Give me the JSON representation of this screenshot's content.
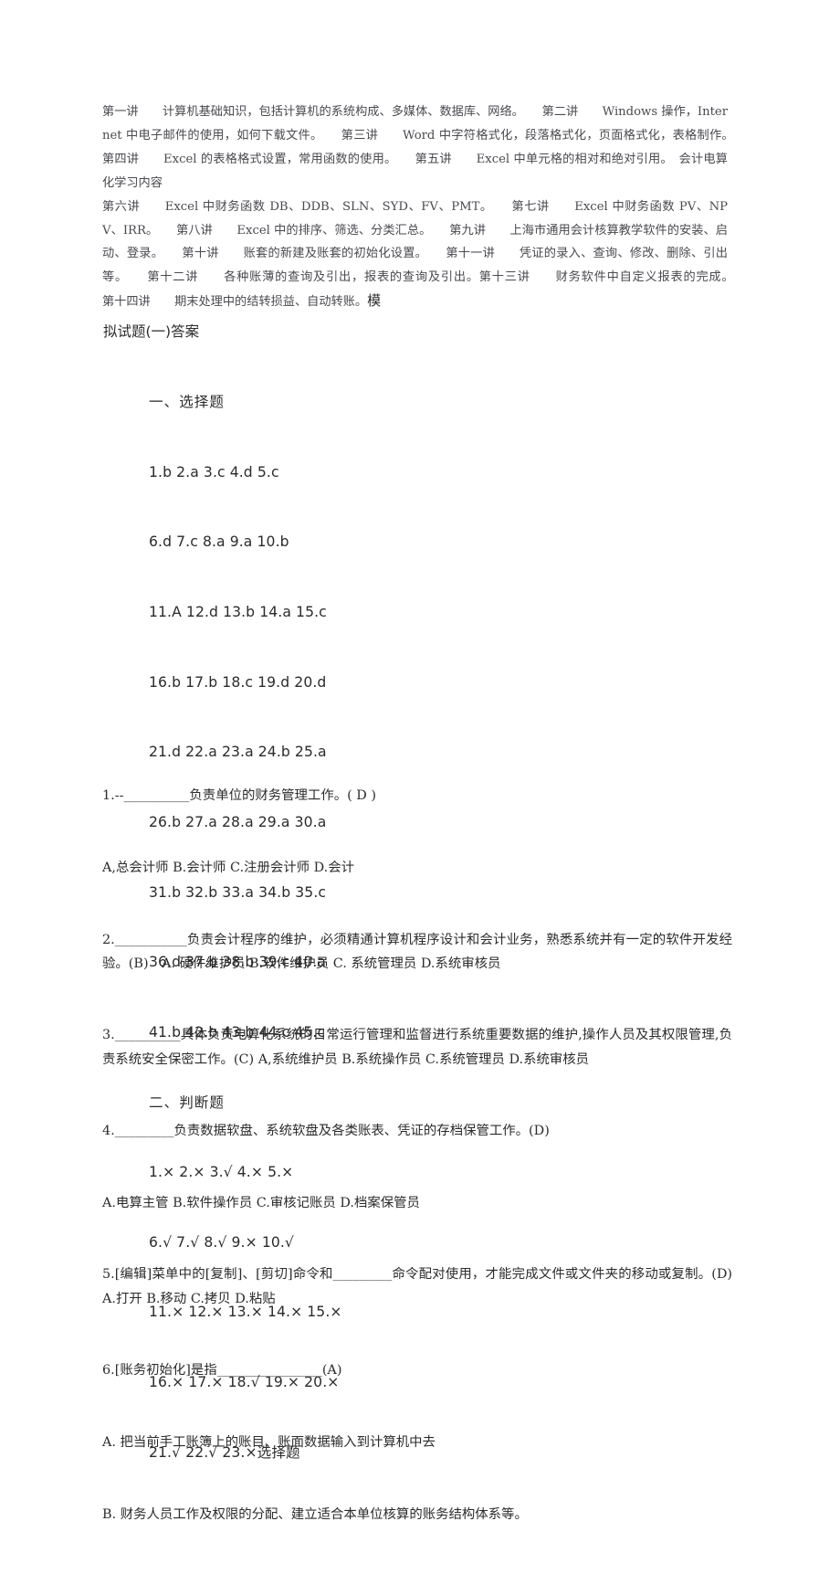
{
  "document": {
    "background_color": "#ffffff",
    "text_color": "#2b2b2b"
  },
  "outline": {
    "body": "第一讲　　计算机基础知识，包括计算机的系统构成、多媒体、数据库、网络。　　第二讲　　Windows 操作，Internet 中电子邮件的使用，如何下载文件。　　第三讲　　Word 中字符格式化，段落格式化，页面格式化，表格制作。　　第四讲　　Excel 的表格格式设置，常用函数的使用。　　第五讲　　Excel 中单元格的相对和绝对引用。　会计电算化学习内容\n第六讲　　Excel 中财务函数 DB、DDB、SLN、SYD、FV、PMT。　　第七讲　　Excel 中财务函数 PV、NPV、IRR。　　第八讲　　Excel 中的排序、筛选、分类汇总。　　第九讲　　上海市通用会计核算教学软件的安装、启动、登录。　　第十讲　　账套的新建及账套的初始化设置。　　第十一讲　　凭证的录入、查询、修改、删除、引出等。　　第十二讲　　各种账薄的查询及引出，报表的查询及引出。第十三讲　　财务软件中自定义报表的完成。　　第十四讲　　期末处理中的结转损益、自动转账。",
    "trailing_lead": "模"
  },
  "answers": {
    "title": "拟试题(一)答案",
    "section_choice_label": "一、选择题",
    "choice_lines": [
      "1.b 2.a 3.c 4.d 5.c",
      "6.d 7.c 8.a 9.a 10.b",
      "11.A 12.d 13.b 14.a 15.c",
      "16.b 17.b 18.c 19.d 20.d",
      "21.d 22.a 23.a 24.b 25.a",
      "26.b 27.a 28.a 29.a 30.a",
      "31.b 32.b 33.a 34.b 35.c",
      "36.d 37.b 38.b 39.c 40.a",
      "41.b 42.b 43.b 44.c 45.c"
    ],
    "section_truefalse_label": "二、判断题",
    "truefalse_lines": [
      "1.× 2.× 3.√ 4.× 5.×",
      "6.√ 7.√ 8.√ 9.× 10.√",
      "11.× 12.× 13.× 14.× 15.×",
      "16.× 17.× 18.√ 19.× 20.×",
      "21.√ 22.√ 23.×选择题"
    ]
  },
  "questions": {
    "items": [
      "1.--__________负责单位的财务管理工作。( D )",
      "A,总会计师 B.会计师 C.注册会计师 D.会计",
      "2.___________负责会计程序的维护，必须精通计算机程序设计和会计业务，熟悉系统并有一定的软件开发经验。(B)　A. 硬件维护员 B.软件维护员 C. 系统管理员 D.系统审核员",
      "3.__________具体负责电算化系统的日常运行管理和监督进行系统重要数据的维护,操作人员及其权限管理,负责系统安全保密工作。(C) A,系统维护员 B.系统操作员 C.系统管理员 D.系统审核员",
      "4._________负责数据软盘、系统软盘及各类账表、凭证的存档保管工作。(D)",
      "A.电算主管 B.软件操作员 C.审核记账员 D.档案保管员",
      "5.[编辑]菜单中的[复制]、[剪切]命令和_________命令配对使用，才能完成文件或文件夹的移动或复制。(D)　A.打开 B.移动 C.拷贝 D.粘贴",
      "6.[账务初始化]是指________________(A)",
      "A. 把当前手工账簿上的账目、账面数据输入到计算机中去",
      "B. 财务人员工作及权限的分配、建立适合本单位核算的账务结构体系等。"
    ]
  }
}
